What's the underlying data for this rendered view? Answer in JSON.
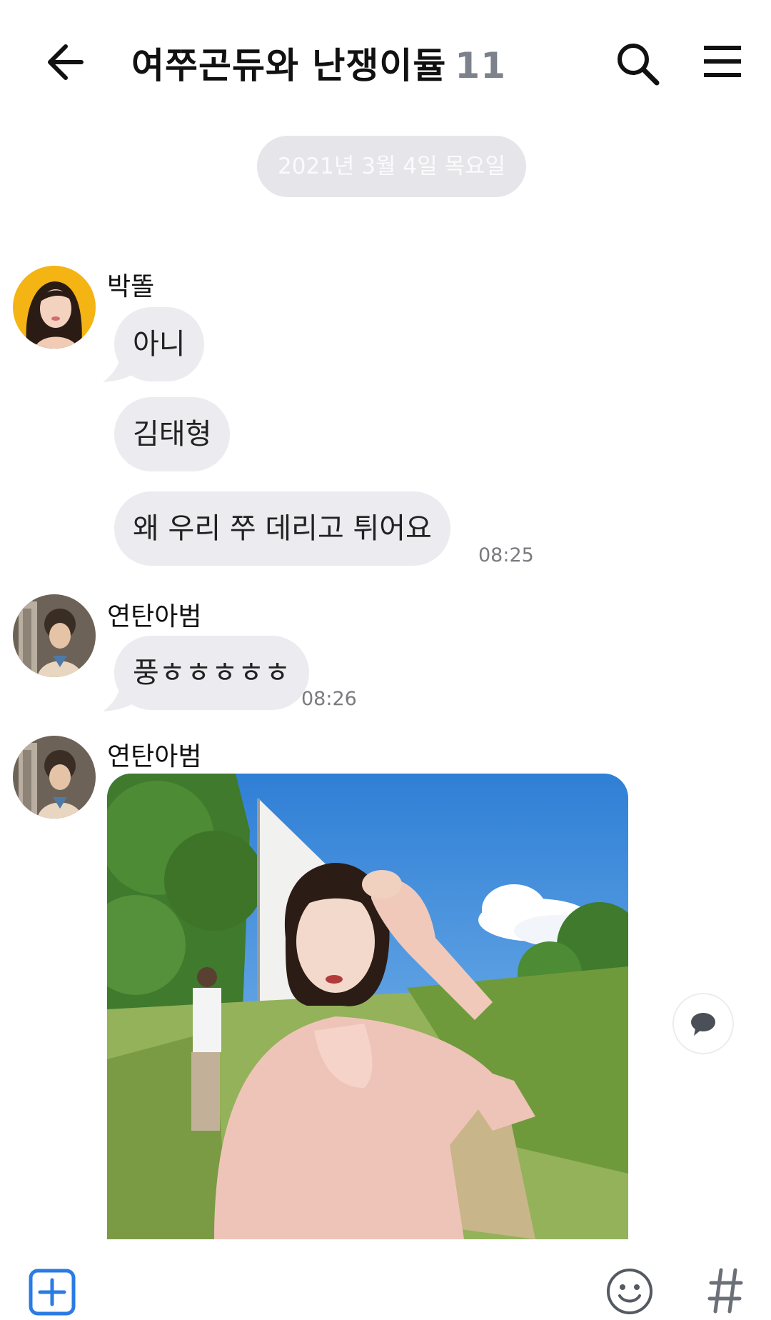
{
  "header": {
    "title": "여쭈곤듀와 난쟁이듈",
    "member_count": "11",
    "back_icon": "arrow-left-icon",
    "search_icon": "search-icon",
    "menu_icon": "hamburger-menu-icon"
  },
  "date_divider": "2021년 3월 4일 목요일",
  "messages": [
    {
      "sender": "박똘",
      "bubbles": [
        "아니",
        "김태형",
        "왜 우리 쭈 데리고 튀어요"
      ],
      "time": "08:25"
    },
    {
      "sender": "연탄아범",
      "bubbles": [
        "풍ㅎㅎㅎㅎㅎ"
      ],
      "time": "08:26"
    },
    {
      "sender": "연탄아범",
      "attachment": "photo"
    }
  ],
  "input_bar": {
    "add_icon": "plus-square-icon",
    "emoji_icon": "smiley-icon",
    "hash_icon": "hash-icon",
    "hash_label": "#"
  },
  "reply_icon": "speech-bubble-icon",
  "colors": {
    "bubble": "#ebebf0",
    "accent": "#2a7be4",
    "muted": "#7c828c"
  }
}
